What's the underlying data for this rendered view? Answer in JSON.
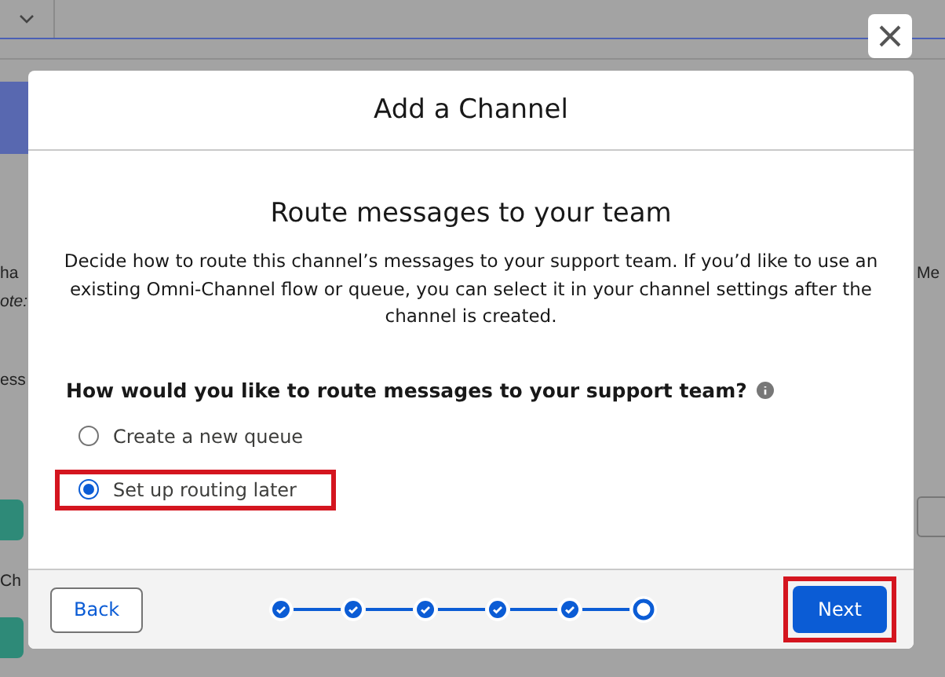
{
  "background": {
    "left_fragments": [
      {
        "text": "ha",
        "italic": false
      },
      {
        "text": "ote:",
        "italic": true
      },
      {
        "text": "ess",
        "italic": false
      },
      {
        "text": "Ch",
        "italic": false
      }
    ],
    "right_fragments": [
      {
        "text": "Me",
        "italic": false
      }
    ]
  },
  "modal": {
    "title": "Add a Channel",
    "heading": "Route messages to your team",
    "description": "Decide how to route this channel’s messages to your support team. If you’d like to use an existing Omni-Channel flow or queue, you can select it in your channel settings after the channel is created.",
    "question": "How would you like to route messages to your support team?",
    "options": [
      {
        "label": "Create a new queue",
        "selected": false,
        "highlighted": false
      },
      {
        "label": "Set up routing later",
        "selected": true,
        "highlighted": true
      }
    ],
    "steps": [
      {
        "completed": true
      },
      {
        "completed": true
      },
      {
        "completed": true
      },
      {
        "completed": true
      },
      {
        "completed": true
      },
      {
        "completed": false
      }
    ],
    "back_button": {
      "label": "Back"
    },
    "next_button": {
      "label": "Next",
      "highlighted": true
    }
  }
}
